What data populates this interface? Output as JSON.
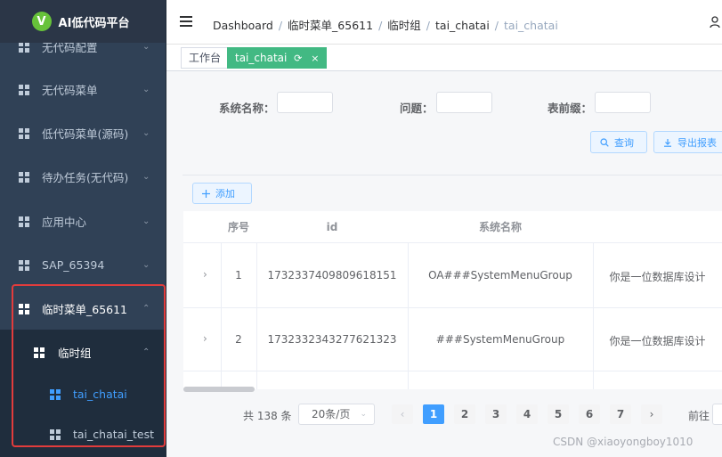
{
  "app": {
    "logo_letter": "V",
    "title": "AI低代码平台"
  },
  "sidebar": {
    "items": [
      {
        "label": "无代码配置"
      },
      {
        "label": "无代码菜单"
      },
      {
        "label": "低代码菜单(源码)"
      },
      {
        "label": "待办任务(无代码)"
      },
      {
        "label": "应用中心"
      },
      {
        "label": "SAP_65394"
      },
      {
        "label": "临时菜单_65611"
      }
    ],
    "submenu": {
      "label": "临时组"
    },
    "children": [
      {
        "label": "tai_chatai",
        "active": true
      },
      {
        "label": "tai_chatai_test"
      }
    ],
    "chevron_down": "⌄",
    "chevron_up": "⌃"
  },
  "breadcrumb": [
    "Dashboard",
    "临时菜单_65611",
    "临时组",
    "tai_chatai",
    "tai_chatai"
  ],
  "breadcrumb_sep": "/",
  "tags": [
    {
      "label": "工作台"
    },
    {
      "label": "tai_chatai",
      "active": true,
      "refresh": "⟳",
      "close": "×"
    }
  ],
  "search": {
    "fields": [
      {
        "label": "系统名称：",
        "value": ""
      },
      {
        "label": "问题：",
        "value": ""
      },
      {
        "label": "表前缀：",
        "value": ""
      }
    ],
    "query_button": "查询",
    "query_icon": "search-icon",
    "export_button": "导出报表",
    "export_icon": "download-icon"
  },
  "add_button": "添加",
  "table": {
    "columns": [
      "",
      "序号",
      "id",
      "系统名称",
      ""
    ],
    "rows": [
      {
        "expand": "›",
        "index": "1",
        "id": "1732337409809618151",
        "system_name": "OA###SystemMenuGroup",
        "question": "你是一位数据库设计"
      },
      {
        "expand": "›",
        "index": "2",
        "id": "1732332343277621323",
        "system_name": "###SystemMenuGroup",
        "question": "你是一位数据库设计"
      }
    ]
  },
  "pagination": {
    "total": "共 138 条",
    "page_size": "20条/页",
    "pages": [
      "1",
      "2",
      "3",
      "4",
      "5",
      "6",
      "7"
    ],
    "current_page": 1,
    "prev": "‹",
    "next": "›",
    "goto": "前往"
  },
  "watermark": "CSDN @xiaoyongboy1010",
  "colors": {
    "sidebar_bg": "#304156",
    "sidebar_sub_bg": "#1f2d3d",
    "accent": "#409eff",
    "tag_active": "#42b983",
    "highlight_box": "#e23c3c"
  }
}
